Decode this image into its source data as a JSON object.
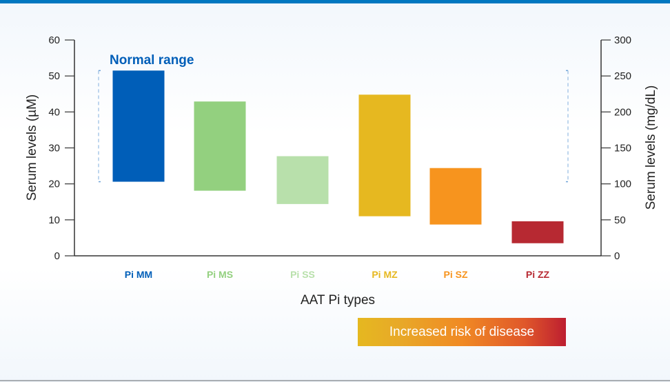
{
  "chart_data": {
    "type": "bar",
    "subtype": "floating-range",
    "xlabel": "AAT Pi types",
    "ylabel": "Serum levels (µM)",
    "ylabel_right": "Serum levels (mg/dL)",
    "ylim": [
      0,
      60
    ],
    "ylim_right": [
      0,
      300
    ],
    "yticks": [
      0,
      10,
      20,
      30,
      40,
      50,
      60
    ],
    "yticks_right": [
      0,
      50,
      100,
      150,
      200,
      250,
      300
    ],
    "grid": false,
    "categories": [
      "Pi MM",
      "Pi MS",
      "Pi SS",
      "Pi MZ",
      "Pi SZ",
      "Pi ZZ"
    ],
    "ranges": [
      [
        20.6,
        51.5
      ],
      [
        18.1,
        42.9
      ],
      [
        14.4,
        27.7
      ],
      [
        11.0,
        44.8
      ],
      [
        8.7,
        24.4
      ],
      [
        3.5,
        9.6
      ]
    ],
    "colors": [
      "#005eb8",
      "#93d07f",
      "#b8e0ab",
      "#e6b820",
      "#f7941e",
      "#b72932"
    ],
    "annotation": {
      "label": "Normal range",
      "range": [
        20.6,
        51.5
      ],
      "color": "#005eb8"
    }
  },
  "legend": {
    "risk_label": "Increased risk of disease"
  }
}
